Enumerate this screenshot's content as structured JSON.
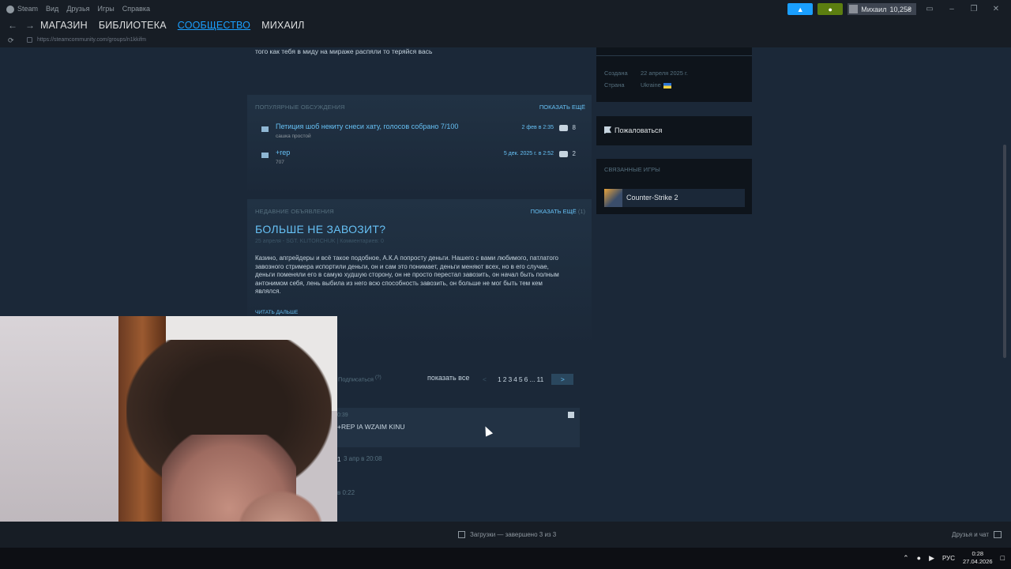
{
  "titlebar": {
    "menu": [
      "Steam",
      "Вид",
      "Друзья",
      "Игры",
      "Справка"
    ],
    "account_name": "Михаил",
    "balance": "10,25₴",
    "colors": {
      "announce_button": "#1a9fff",
      "notify_button": "#5c7e10"
    }
  },
  "navbar": {
    "links": [
      "МАГАЗИН",
      "БИБЛИОТЕКА",
      "СООБЩЕСТВО",
      "МИХАИЛ"
    ],
    "active_index": 2
  },
  "urlbar": {
    "url": "https://steamcommunity.com/groups/n1kkifm"
  },
  "top_text": {
    "line_cut": "того как тебя в миду на мираже распяли то теряйся вась"
  },
  "discussions": {
    "heading": "ПОПУЛЯРНЫЕ ОБСУЖДЕНИЯ",
    "show_more": "ПОКАЗАТЬ ЕЩЁ",
    "items": [
      {
        "title": "Петиция шоб некиту снеси хату, голосов собрано 7/100",
        "author": "сашка простой",
        "date": "2 фев в 2:35",
        "replies": "8"
      },
      {
        "title": "+rep",
        "author": "707",
        "date": "5 дек. 2025 г. в 2:52",
        "replies": "2"
      }
    ]
  },
  "announcement": {
    "heading": "НЕДАВНИЕ ОБЪЯВЛЕНИЯ",
    "show_more": "ПОКАЗАТЬ ЕЩЁ",
    "show_more_count": "(1)",
    "title": "БОЛЬШЕ НЕ ЗАВОЗИТ?",
    "meta": "25 апреля - SGT. KLITORCHUK | Комментариев: 0",
    "body": "Казино, апгрейдеры и всё такое подобное, А.К.А попросту деньги. Нашего с вами любимого, патлатого завозного стримера испортили деньги, он и сам это понимает, деньги меняют всех, но в его случае, деньги поменяли его в самую худшую сторону, он не просто перестал завозить, он начал быть полным антонимом себя, лень выбила из него всю способность завозить, он больше не мог быть тем кем являлся.",
    "read_more": "ЧИТАТЬ ДАЛЬШЕ"
  },
  "comments": {
    "subscribe": "Подписаться",
    "subscribe_count": "(?)",
    "show_all": "показать все",
    "pager": {
      "prev": "<",
      "pages": [
        "1",
        "2",
        "3",
        "4",
        "5",
        "6",
        "...",
        "11"
      ],
      "next": ">"
    },
    "items": [
      {
        "time": "0:39",
        "text": "+REP IA WZAIM KINU"
      },
      {
        "prefix": "1",
        "time": "3 апр в 20:08"
      },
      {
        "time": "в 0:22"
      }
    ]
  },
  "sidebar": {
    "created_label": "Создана",
    "created_value": "22 апреля 2025 г.",
    "country_label": "Страна",
    "country_value": "Ukraine",
    "report_label": "Пожаловаться",
    "related_heading": "СВЯЗАННЫЕ ИГРЫ",
    "related_game": "Counter-Strike 2"
  },
  "statusbar": {
    "downloads": "Загрузки — завершено 3 из 3",
    "friends": "Друзья и чат"
  },
  "taskbar": {
    "lang": "РУС",
    "time": "0:28",
    "date": "27.04.2026"
  }
}
